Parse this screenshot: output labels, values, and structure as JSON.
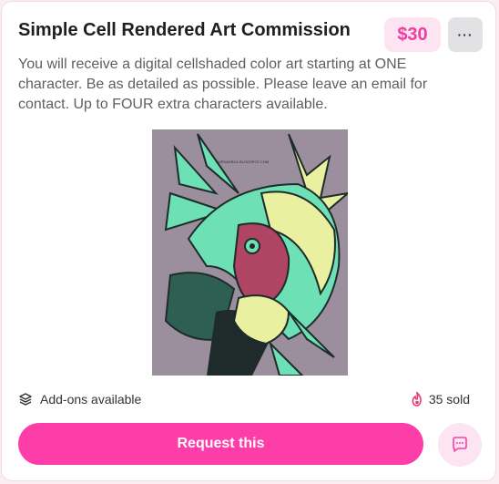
{
  "listing": {
    "title": "Simple Cell Rendered Art Commission",
    "price": "$30",
    "more_label": "···",
    "description": "You will receive a digital cellshaded color art starting at ONE character. Be as detailed as possible. Please leave an email for contact. Up to FOUR extra characters available.",
    "artwork": {
      "watermark": "CUPKADRO1.BLOGSPOT.COM",
      "colors": {
        "background": "#9b8f9e",
        "hair": "#6de0b5",
        "hair_dark": "#2f5e52",
        "skin": "#e9f0a0",
        "accent": "#b04463",
        "shadow": "#1f2b2a"
      }
    },
    "addons_label": "Add-ons available",
    "sold_label": "35 sold",
    "request_label": "Request this",
    "icons": {
      "addons": "layers-icon",
      "sold": "flame-icon",
      "chat": "chat-bubble-icon",
      "more": "ellipsis-icon"
    },
    "colors": {
      "accent": "#fd3ea9",
      "price_bg": "#fce4f1",
      "price_text": "#ef3ea3"
    }
  }
}
